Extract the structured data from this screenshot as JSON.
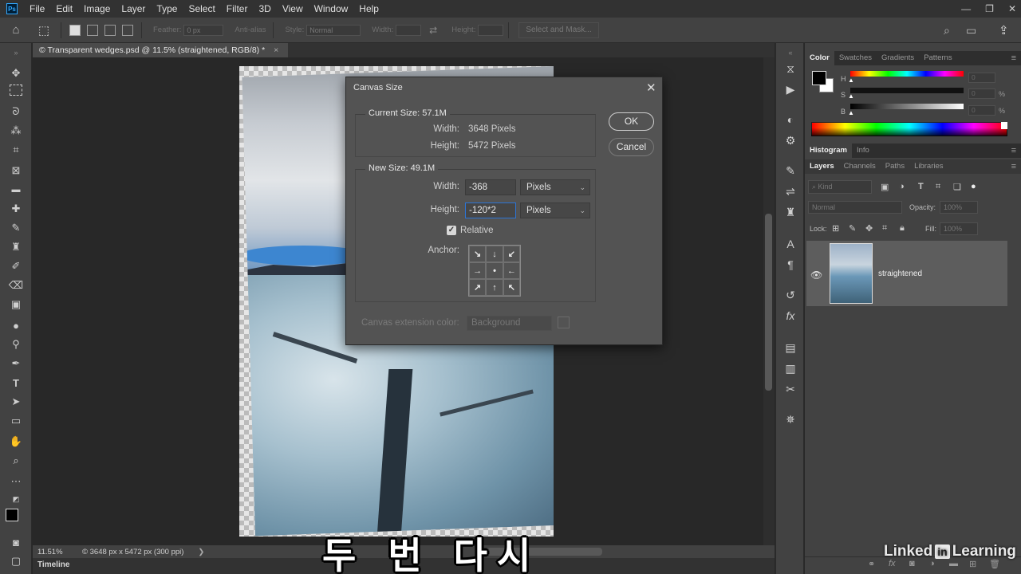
{
  "app": {
    "logo": "Ps"
  },
  "menubar": {
    "items": [
      "File",
      "Edit",
      "Image",
      "Layer",
      "Type",
      "Select",
      "Filter",
      "3D",
      "View",
      "Window",
      "Help"
    ]
  },
  "window_controls": {
    "minimize": "—",
    "restore": "❐",
    "close": "✕"
  },
  "options_bar": {
    "feather_label": "Feather:",
    "feather_value": "0 px",
    "antialias_label": "Anti-alias",
    "style_label": "Style:",
    "style_value": "Normal",
    "width_label": "Width:",
    "height_label": "Height:",
    "select_mask_label": "Select and Mask..."
  },
  "document": {
    "tab_title": "© Transparent wedges.psd @ 11.5% (straightened, RGB/8) *",
    "tab_close": "×"
  },
  "status": {
    "zoom": "11.51%",
    "info": "© 3648 px x 5472 px (300 ppi)",
    "arrow": "❯"
  },
  "timeline": {
    "label": "Timeline"
  },
  "subtitle": {
    "text": "두 번 다시"
  },
  "dialog": {
    "title": "Canvas Size",
    "close": "✕",
    "current_size": {
      "title": "Current Size: 57.1M",
      "width_label": "Width:",
      "width_value": "3648 Pixels",
      "height_label": "Height:",
      "height_value": "5472 Pixels"
    },
    "new_size": {
      "title": "New Size: 49.1M",
      "width_label": "Width:",
      "width_value": "-368",
      "width_unit": "Pixels",
      "height_label": "Height:",
      "height_value": "-120*2",
      "height_unit": "Pixels",
      "relative_label": "Relative",
      "relative_checked": true,
      "anchor_label": "Anchor:",
      "anchor_arrows": [
        "↘",
        "↓",
        "↙",
        "→",
        "•",
        "←",
        "↗",
        "↑",
        "↖"
      ]
    },
    "ext_color_label": "Canvas extension color:",
    "ext_color_value": "Background",
    "ok": "OK",
    "cancel": "Cancel"
  },
  "color_panel": {
    "tabs": [
      "Color",
      "Swatches",
      "Gradients",
      "Patterns"
    ],
    "h_label": "H",
    "s_label": "S",
    "b_label": "B",
    "h_value": "0",
    "s_value": "0",
    "b_value": "0",
    "pct": "%"
  },
  "histogram_tabs": [
    "Histogram",
    "Info"
  ],
  "layers_panel": {
    "tabs": [
      "Layers",
      "Channels",
      "Paths",
      "Libraries"
    ],
    "search_placeholder": "Kind",
    "blend_mode": "Normal",
    "opacity_label": "Opacity:",
    "opacity_value": "100%",
    "lock_label": "Lock:",
    "fill_label": "Fill:",
    "fill_value": "100%",
    "layer_name": "straightened"
  },
  "watermark": {
    "left": "Linked",
    "in": "in",
    "right": "Learning"
  },
  "colors": {
    "accent": "#2c74d6",
    "panel": "#424242",
    "dialog": "#535353"
  }
}
